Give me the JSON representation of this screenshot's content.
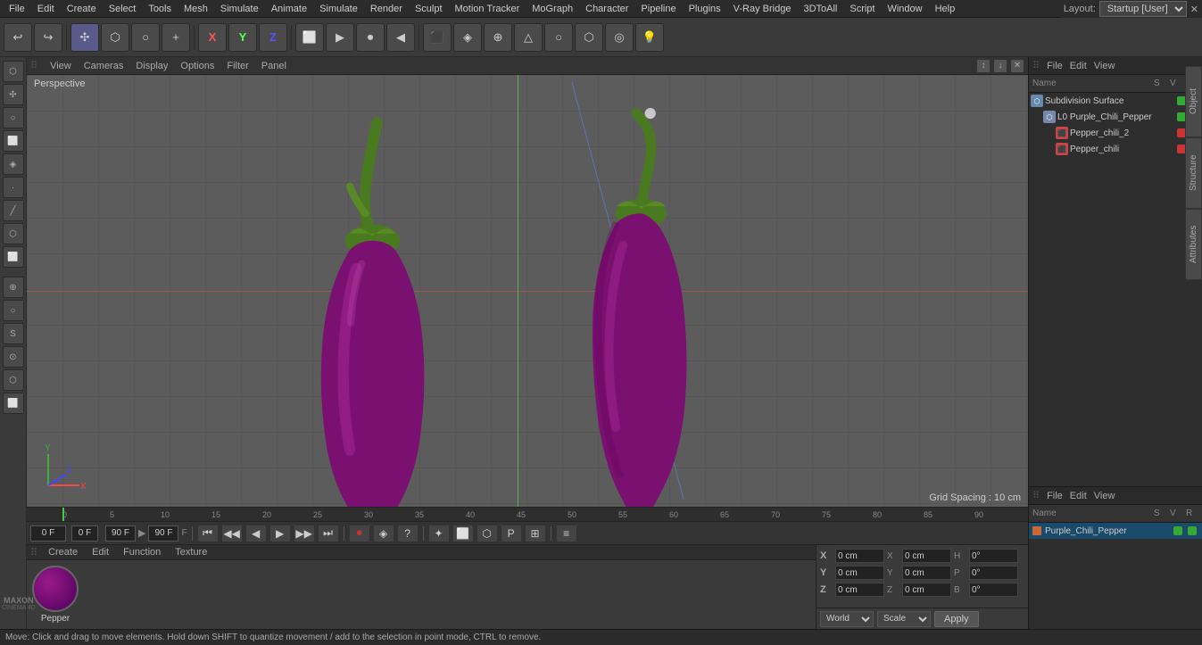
{
  "menubar": {
    "items": [
      "File",
      "Edit",
      "Create",
      "Select",
      "Tools",
      "Mesh",
      "Simulate",
      "Animate",
      "Simulate",
      "Render",
      "Sculpt",
      "Motion Tracker",
      "MoGraph",
      "Character",
      "Pipeline",
      "Plugins",
      "V-Ray Bridge",
      "3DToAll",
      "Script",
      "Window",
      "Help"
    ],
    "layout_label": "Layout:",
    "layout_value": "Startup [User]"
  },
  "toolbar": {
    "buttons": [
      "↩",
      "⬜",
      "✣",
      "○",
      "⬡",
      "+",
      "X",
      "Y",
      "Z",
      "⬜",
      "▶",
      "⏺",
      "◀",
      "⬛",
      "◈",
      "⊕",
      "⊙",
      "◐",
      "⌀",
      "⬡",
      "◎",
      "💡"
    ]
  },
  "viewport": {
    "tabs": [
      "View",
      "Cameras",
      "Display",
      "Options",
      "Filter",
      "Panel"
    ],
    "perspective_label": "Perspective",
    "grid_spacing": "Grid Spacing : 10 cm"
  },
  "timeline": {
    "ticks": [
      "0",
      "5",
      "10",
      "15",
      "20",
      "25",
      "30",
      "35",
      "40",
      "45",
      "50",
      "55",
      "60",
      "65",
      "70",
      "75",
      "80",
      "85",
      "90",
      "0F",
      "90 F"
    ]
  },
  "transport": {
    "frame_start": "0 F",
    "frame_end": "90 F",
    "frame_current": "0 F",
    "fps": "90 F",
    "fps2": "90 F"
  },
  "bottom_panel": {
    "tabs": [
      "Create",
      "Edit",
      "Function",
      "Texture"
    ],
    "material_name": "Pepper"
  },
  "coordinates": {
    "x_label": "X",
    "y_label": "Y",
    "z_label": "Z",
    "x_pos": "0 cm",
    "y_pos": "0 cm",
    "z_pos": "0 cm",
    "x_size": "0 cm",
    "y_size": "0 cm",
    "z_size": "0 cm",
    "h_label": "H",
    "p_label": "P",
    "b_label": "B",
    "h_val": "0°",
    "p_val": "0°",
    "b_val": "0°",
    "world_label": "World",
    "scale_label": "Scale",
    "apply_label": "Apply"
  },
  "object_manager": {
    "menu": [
      "File",
      "Edit",
      "View"
    ],
    "col_headers": [
      "Name",
      "S",
      "V",
      "R"
    ],
    "objects": [
      {
        "name": "Subdivision Surface",
        "indent": 0,
        "icon_color": "#6688aa",
        "dot1": "green",
        "dot2": "green",
        "has_arrow": false
      },
      {
        "name": "L0 Purple_Chili_Pepper",
        "indent": 1,
        "icon_color": "#7788aa",
        "dot1": "green",
        "dot2": "green",
        "has_arrow": false
      },
      {
        "name": "Pepper_chili_2",
        "indent": 2,
        "icon_color": "#cc4444",
        "dot1": "red",
        "dot2": "red",
        "has_arrow": false
      },
      {
        "name": "Pepper_chili",
        "indent": 2,
        "icon_color": "#cc4444",
        "dot1": "red",
        "dot2": "red",
        "has_arrow": false
      }
    ]
  },
  "attr_manager": {
    "menu": [
      "File",
      "Edit",
      "View"
    ],
    "col_headers": [
      "Name",
      "S",
      "V",
      "R"
    ],
    "objects": [
      {
        "name": "Purple_Chili_Pepper",
        "indent": 0,
        "icon_color": "#6688aa",
        "dot1": "green",
        "dot2": "green"
      }
    ]
  },
  "side_tabs": [
    "Object",
    "Structure",
    "Attributes"
  ],
  "status_bar": {
    "text": "Move: Click and drag to move elements. Hold down SHIFT to quantize movement / add to the selection in point mode, CTRL to remove."
  }
}
